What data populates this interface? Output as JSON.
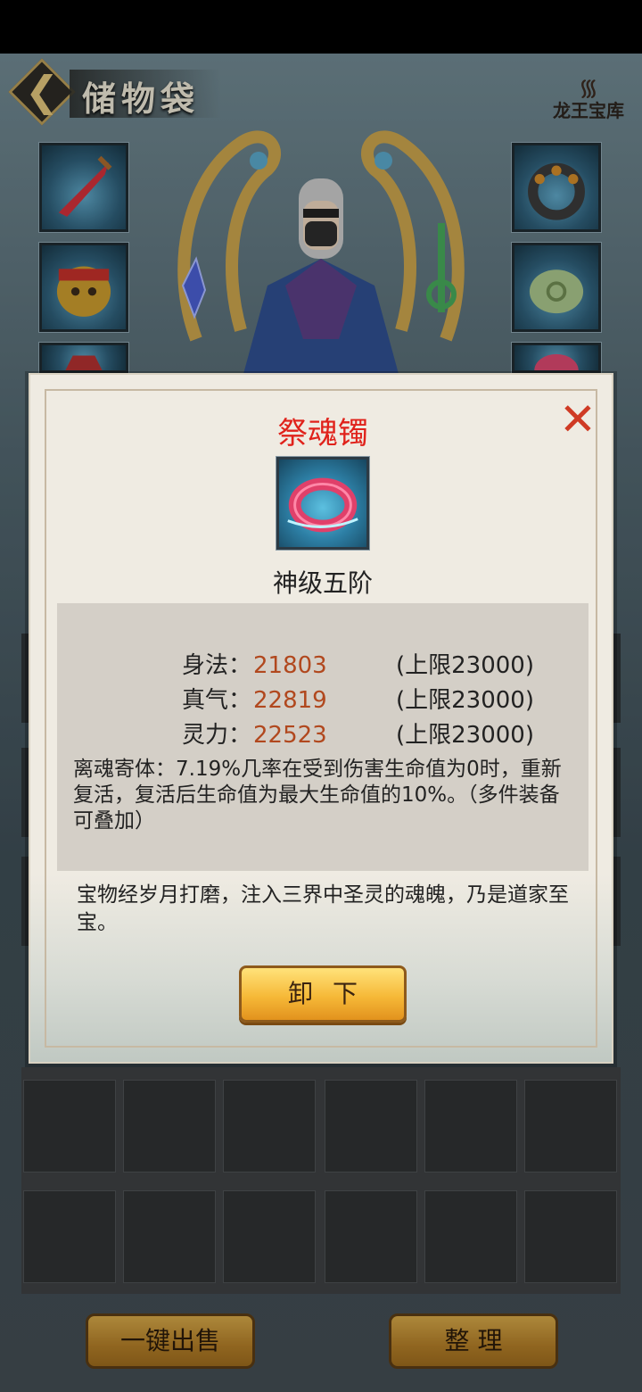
{
  "header": {
    "title": "储物袋",
    "logo_text": "龙王宝库"
  },
  "popup": {
    "item_name": "祭魂镯",
    "item_grade": "神级五阶",
    "stats": [
      {
        "name": "身法：",
        "value": "21803",
        "limit": "(上限23000)"
      },
      {
        "name": "真气：",
        "value": "22819",
        "limit": "(上限23000)"
      },
      {
        "name": "灵力：",
        "value": "22523",
        "limit": "(上限23000)"
      }
    ],
    "skill": "离魂寄体：7.19%几率在受到伤害生命值为0时，重新复活，复活后生命值为最大生命值的10%。（多件装备可叠加）",
    "description": "宝物经岁月打磨，注入三界中圣灵的魂魄，乃是道家至宝。",
    "unequip_label": "卸下"
  },
  "bottom": {
    "sell_all_label": "一键出售",
    "sort_label": "整 理"
  },
  "colors": {
    "item_name": "#e0221b",
    "stat_value": "#b1481e",
    "button_gold": "#f6b938"
  },
  "icons": {
    "back": "chevron-left-icon",
    "close": "close-icon",
    "equipped_item": "ring-icon"
  }
}
